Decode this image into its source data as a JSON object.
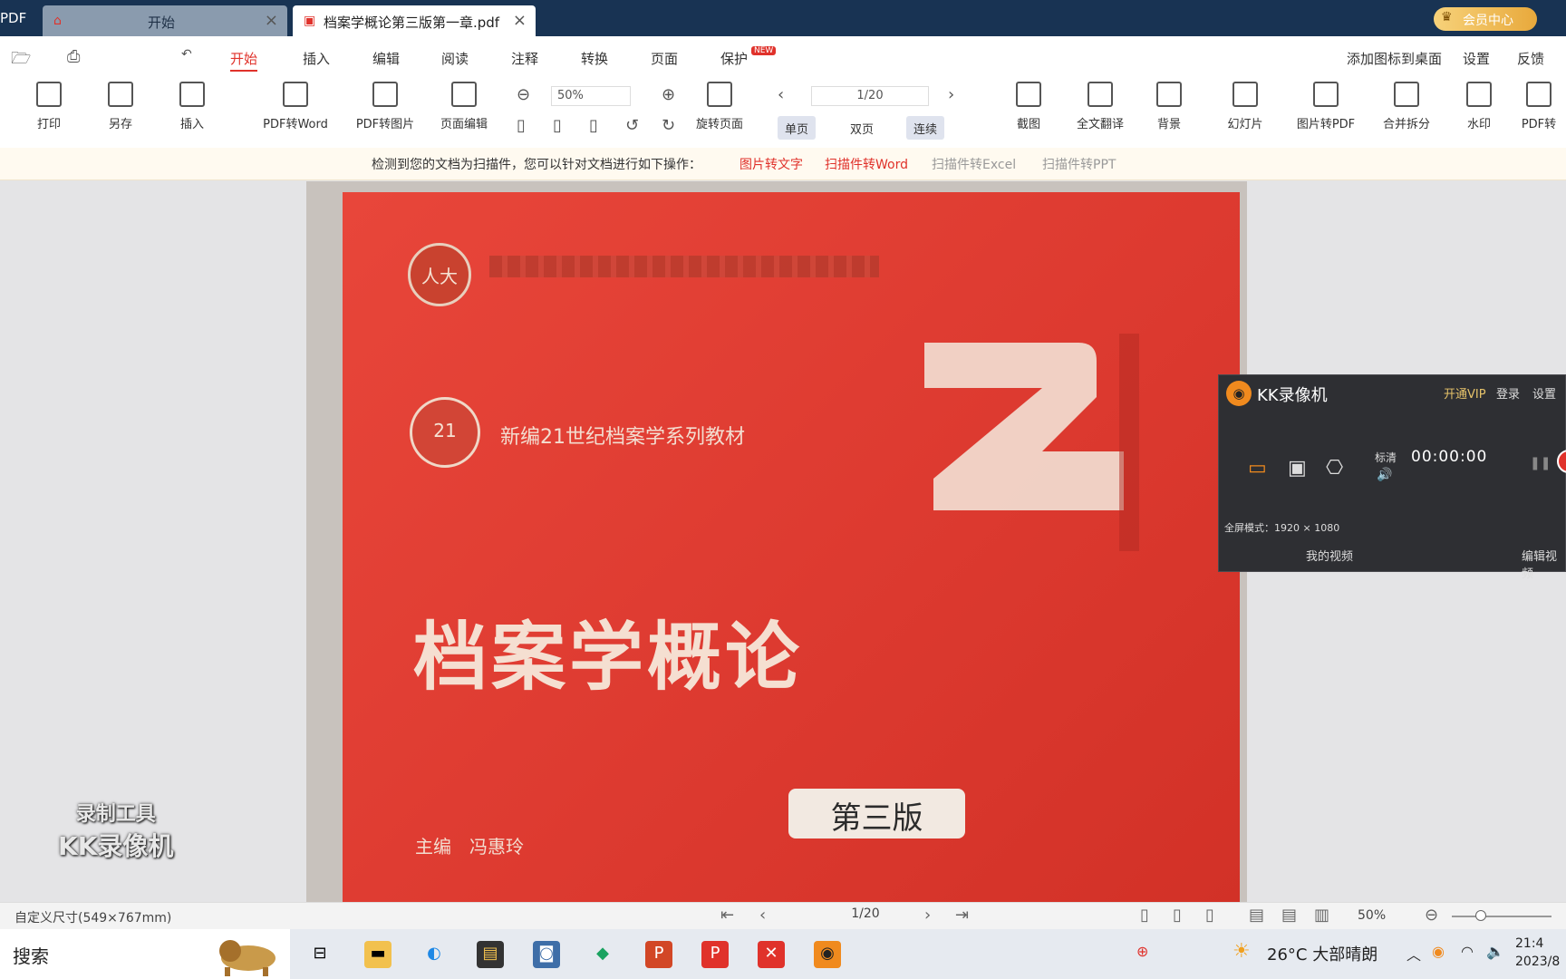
{
  "window": {
    "app_name": "PDF",
    "tabs": [
      {
        "label": "开始",
        "icon": "home-icon"
      },
      {
        "label": "档案学概论第三版第一章.pdf",
        "icon": "pdf-file-icon"
      }
    ],
    "vip_label": "会员中心"
  },
  "menubar": {
    "items": [
      "开始",
      "插入",
      "编辑",
      "阅读",
      "注释",
      "转换",
      "页面",
      "保护"
    ],
    "active": "开始",
    "new_badge": "NEW",
    "right_items": [
      "添加图标到桌面",
      "设置",
      "反馈"
    ]
  },
  "toolbar": {
    "tools": [
      {
        "label": "打印",
        "icon": "printer-icon"
      },
      {
        "label": "另存",
        "icon": "save-as-icon"
      },
      {
        "label": "插入",
        "icon": "insert-icon"
      },
      {
        "label": "PDF转Word",
        "icon": "pdf-to-word-icon"
      },
      {
        "label": "PDF转图片",
        "icon": "pdf-to-image-icon"
      },
      {
        "label": "页面编辑",
        "icon": "page-edit-icon"
      },
      {
        "label": "旋转页面",
        "icon": "rotate-page-icon"
      },
      {
        "label": "截图",
        "icon": "screenshot-icon"
      },
      {
        "label": "全文翻译",
        "icon": "translate-icon"
      },
      {
        "label": "背景",
        "icon": "background-icon"
      },
      {
        "label": "幻灯片",
        "icon": "slideshow-icon"
      },
      {
        "label": "图片转PDF",
        "icon": "image-to-pdf-icon"
      },
      {
        "label": "合并拆分",
        "icon": "merge-split-icon"
      },
      {
        "label": "水印",
        "icon": "watermark-icon"
      },
      {
        "label": "PDF转",
        "icon": "pdf-convert-icon"
      }
    ],
    "zoom_value": "50%",
    "page_value": "1/20",
    "view_modes": [
      "单页",
      "双页",
      "连续"
    ]
  },
  "notice": {
    "message": "检测到您的文档为扫描件，您可以针对文档进行如下操作：",
    "actions": [
      "图片转文字",
      "扫描件转Word",
      "扫描件转Excel",
      "扫描件转PPT"
    ]
  },
  "document": {
    "series": "新编21世纪档案学系列教材",
    "publisher_mark": "人大",
    "series_mark": "21",
    "title": "档案学概论",
    "edition": "第三版",
    "editor_role": "主编",
    "editor_name": "冯惠玲"
  },
  "recorder": {
    "name": "KK录像机",
    "open_vip": "开通VIP",
    "login": "登录",
    "settings": "设置",
    "quality": "标清",
    "timer": "00:00:00",
    "fullscreen_mode": "全屏模式：1920 × 1080",
    "my_videos": "我的视频",
    "edit_videos": "编辑视频",
    "watermark_line1": "录制工具",
    "watermark_line2": "KK录像机"
  },
  "statusbar": {
    "page_size": "自定义尺寸(549×767mm)",
    "page_indicator": "1/20",
    "zoom": "50%"
  },
  "taskbar": {
    "search_label": "搜索",
    "weather": "26°C  大部晴朗",
    "time": "21:4",
    "date": "2023/8"
  },
  "colors": {
    "titlebar": "#183353",
    "accent": "#e0322b",
    "cover_red": "#dd3a30",
    "recorder_bg": "#2e2f33"
  }
}
